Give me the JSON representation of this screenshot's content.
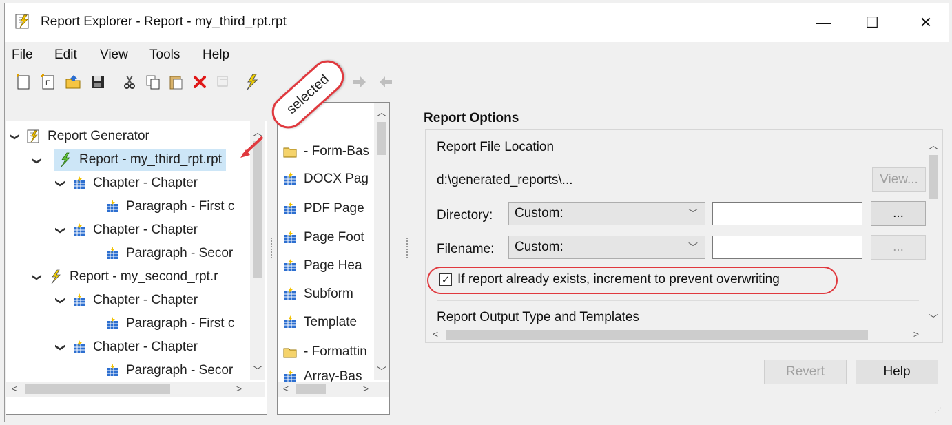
{
  "window": {
    "title": "Report Explorer - Report - my_third_rpt.rpt",
    "minimize": "—",
    "maximize": "☐",
    "close": "✕"
  },
  "menu": [
    "File",
    "Edit",
    "View",
    "Tools",
    "Help"
  ],
  "toolbar": {
    "icons": [
      "new-report-icon",
      "new-form-icon",
      "open-icon",
      "save-icon",
      "cut-icon",
      "copy-icon",
      "paste-icon",
      "delete-icon",
      "disabled-icon",
      "run-report-icon",
      "move-up-icon",
      "move-right-icon",
      "move-left-icon"
    ]
  },
  "callout": {
    "text": "selected"
  },
  "tree": {
    "items": [
      {
        "label": "Report Generator",
        "kind": "root"
      },
      {
        "label": "Report - my_third_rpt.rpt",
        "kind": "report",
        "selected": true
      },
      {
        "label": "Chapter - Chapter",
        "kind": "chapter"
      },
      {
        "label": "Paragraph - First c",
        "kind": "paragraph"
      },
      {
        "label": "Chapter - Chapter",
        "kind": "chapter"
      },
      {
        "label": "Paragraph - Secor",
        "kind": "paragraph"
      },
      {
        "label": "Report - my_second_rpt.r",
        "kind": "report"
      },
      {
        "label": "Chapter - Chapter",
        "kind": "chapter"
      },
      {
        "label": "Paragraph - First c",
        "kind": "paragraph"
      },
      {
        "label": "Chapter - Chapter",
        "kind": "chapter"
      },
      {
        "label": "Paragraph - Secor",
        "kind": "paragraph"
      }
    ]
  },
  "library": {
    "items": [
      {
        "label": "-  Form-Bas",
        "icon": "folder"
      },
      {
        "label": "DOCX Pag",
        "icon": "component"
      },
      {
        "label": "PDF Page",
        "icon": "component"
      },
      {
        "label": "Page Foot",
        "icon": "component"
      },
      {
        "label": "Page Hea",
        "icon": "component"
      },
      {
        "label": "Subform",
        "icon": "component"
      },
      {
        "label": "Template",
        "icon": "component"
      },
      {
        "label": "-  Formattin",
        "icon": "folder"
      },
      {
        "label": "Array-Bas",
        "icon": "component"
      }
    ]
  },
  "options": {
    "title": "Report Options",
    "file_location_heading": "Report File Location",
    "path": "d:\\generated_reports\\...",
    "view_button": "View...",
    "directory_label": "Directory:",
    "directory_value": "Custom:",
    "filename_label": "Filename:",
    "filename_value": "Custom:",
    "browse_button": "...",
    "increment_checkbox": "If report already exists, increment to prevent overwriting",
    "output_heading": "Report Output Type and Templates",
    "revert_button": "Revert",
    "help_button": "Help"
  },
  "colors": {
    "selection": "#cde6f7",
    "annotation_red": "#e0393e"
  }
}
